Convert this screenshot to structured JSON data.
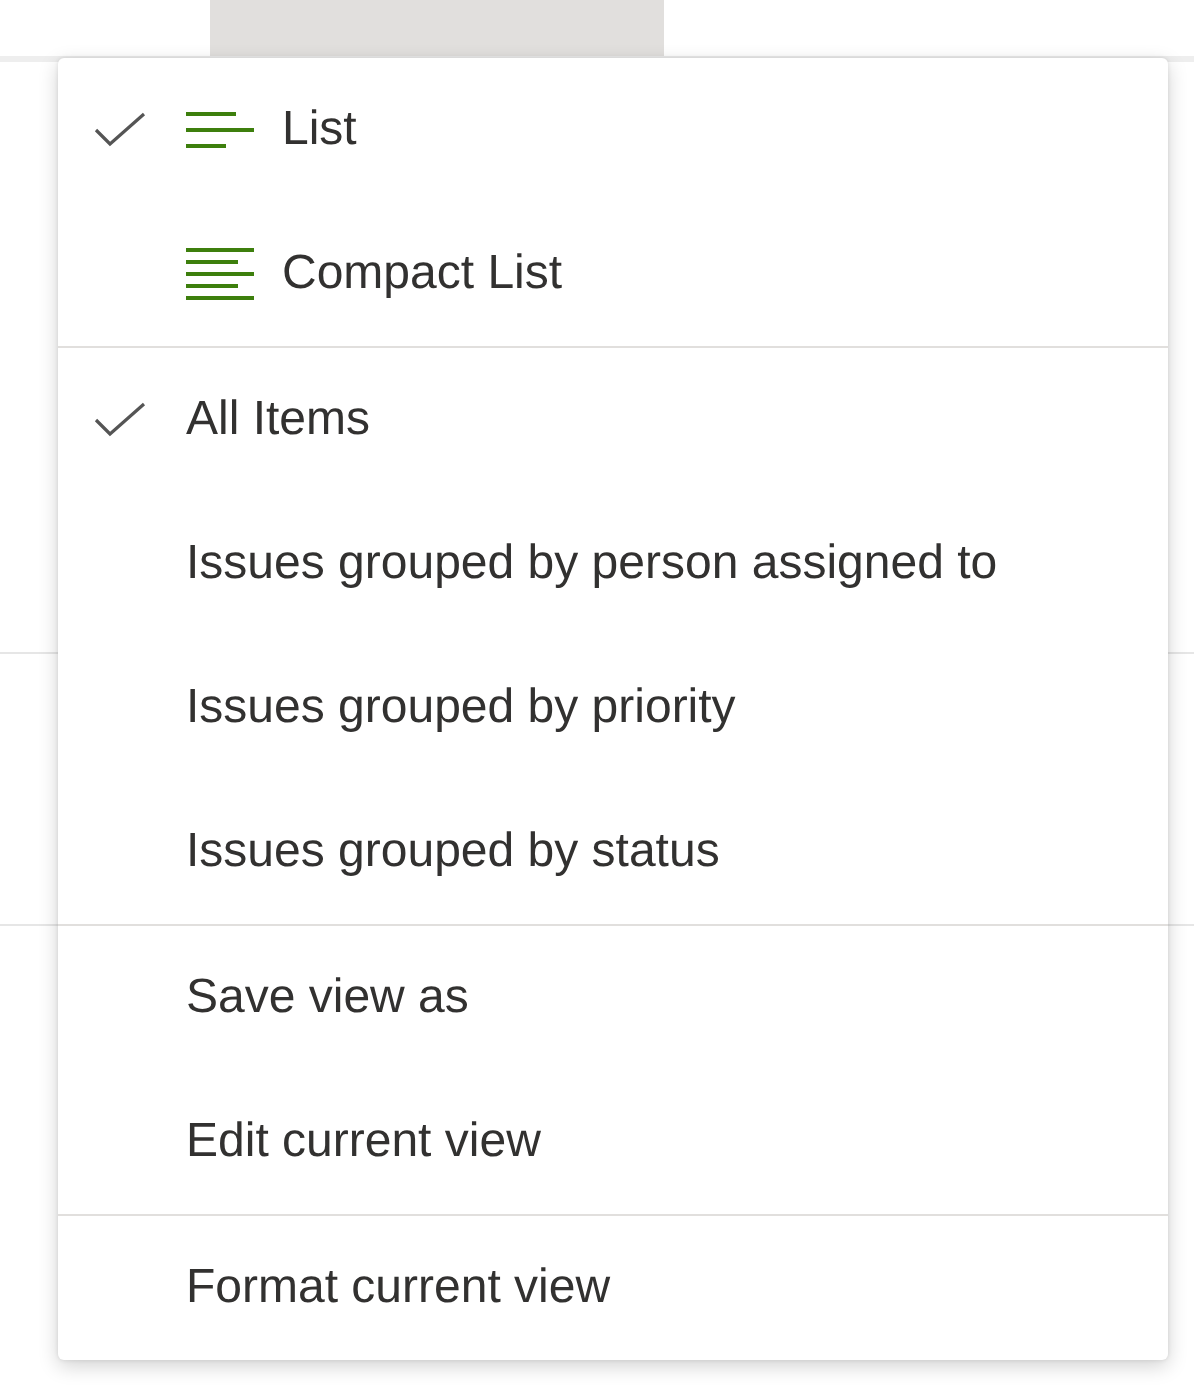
{
  "menu": {
    "sections": [
      {
        "items": [
          {
            "label": "List",
            "checked": true,
            "kind": "list"
          },
          {
            "label": "Compact List",
            "checked": false,
            "kind": "compact"
          }
        ]
      },
      {
        "items": [
          {
            "label": "All Items",
            "checked": true
          },
          {
            "label": "Issues grouped by person assigned to",
            "checked": false
          },
          {
            "label": "Issues grouped by priority",
            "checked": false
          },
          {
            "label": "Issues grouped by status",
            "checked": false
          }
        ]
      },
      {
        "items": [
          {
            "label": "Save view as",
            "checked": false
          },
          {
            "label": "Edit current view",
            "checked": false
          }
        ]
      },
      {
        "items": [
          {
            "label": "Format current view",
            "checked": false
          }
        ]
      }
    ]
  }
}
